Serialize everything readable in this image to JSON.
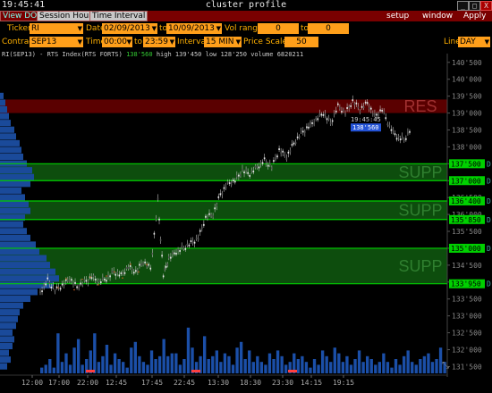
{
  "window": {
    "clock": "19:45:41",
    "title": "cluster profile",
    "minimize": "_",
    "maximize": "□",
    "close": "X"
  },
  "menu": {
    "left_tabs": [
      "View DOM",
      "Session Hours",
      "Time Interval"
    ],
    "right_items": [
      "setup",
      "window",
      "Apply"
    ]
  },
  "toolbar": {
    "ticker_label": "Ticker",
    "ticker": "RI",
    "date_label": "Date",
    "date_from": "02/09/2013",
    "date_to_label": "to",
    "date_to": "10/09/2013",
    "vol_label": "Vol range",
    "vol_from": "0",
    "vol_to_label": "to",
    "vol_to": "0",
    "contract_label": "Contract",
    "contract": "SEP13",
    "time_label": "Time",
    "time_from": "00:00",
    "time_to_label": "to",
    "time_to": "23:59",
    "interval_label": "Interval",
    "interval": "15 MIN",
    "price_scale_label": "Price Scale",
    "price_scale": "50",
    "line_label": "Line",
    "line": "DAY"
  },
  "info": {
    "symbol": "RI(SEP13) - RTS Index(RTS FORTS)",
    "last": "138'560",
    "high": "high 139'450",
    "low": "low 128'250",
    "volume": "volume 6820211"
  },
  "chart_data": {
    "type": "candlestick-with-volume-profile",
    "y_ticks": [
      "140'500",
      "140'000",
      "139'500",
      "139'000",
      "138'500",
      "138'000",
      "137'500",
      "137'000",
      "136'500",
      "136'000",
      "135'500",
      "135'000",
      "134'500",
      "134'000",
      "133'500",
      "133'000",
      "132'500",
      "132'000",
      "131'500"
    ],
    "ylim": [
      131300,
      140600
    ],
    "x_ticks": [
      "12:00",
      "17:00",
      "22:00",
      "12:45",
      "17:45",
      "22:45",
      "13:30",
      "18:30",
      "23:30",
      "14:15",
      "19:15"
    ],
    "current_price_time": "19:45:45",
    "current_price": "138'560",
    "zones": [
      {
        "name": "RES",
        "from": 139000,
        "to": 139400,
        "color": "#5a0000",
        "label_color": "#a03030"
      },
      {
        "name": "SUPP",
        "from": 137000,
        "to": 137500,
        "color": "#0d4d0d",
        "label_color": "#2f7f2f"
      },
      {
        "name": "SUPP",
        "from": 135850,
        "to": 136400,
        "color": "#0d4d0d",
        "label_color": "#2f7f2f"
      },
      {
        "name": "SUPP",
        "from": 133950,
        "to": 135000,
        "color": "#0d4d0d",
        "label_color": "#2f7f2f"
      }
    ],
    "levels": [
      {
        "price": 137500,
        "label": "137'500"
      },
      {
        "price": 137000,
        "label": "137'000"
      },
      {
        "price": 136400,
        "label": "136'400"
      },
      {
        "price": 135850,
        "label": "135'850"
      },
      {
        "price": 135000,
        "label": "135'000"
      },
      {
        "price": 133950,
        "label": "133'950"
      }
    ],
    "level_color": "#00d000",
    "level_suffix": "D",
    "price_path": [
      [
        0,
        133700
      ],
      [
        4,
        134050
      ],
      [
        8,
        133750
      ],
      [
        12,
        133900
      ],
      [
        16,
        134100
      ],
      [
        20,
        133850
      ],
      [
        24,
        134000
      ],
      [
        28,
        134150
      ],
      [
        32,
        134000
      ],
      [
        36,
        134100
      ],
      [
        40,
        134300
      ],
      [
        44,
        134200
      ],
      [
        48,
        134450
      ],
      [
        52,
        134300
      ],
      [
        56,
        134600
      ],
      [
        60,
        134400
      ],
      [
        64,
        136400
      ],
      [
        67,
        134200
      ],
      [
        70,
        134700
      ],
      [
        74,
        134900
      ],
      [
        78,
        135000
      ],
      [
        82,
        135150
      ],
      [
        86,
        135300
      ],
      [
        90,
        135900
      ],
      [
        94,
        136000
      ],
      [
        98,
        136600
      ],
      [
        102,
        136900
      ],
      [
        106,
        137000
      ],
      [
        110,
        137300
      ],
      [
        114,
        137200
      ],
      [
        118,
        137400
      ],
      [
        122,
        137600
      ],
      [
        126,
        137400
      ],
      [
        130,
        137900
      ],
      [
        134,
        137700
      ],
      [
        138,
        138100
      ],
      [
        142,
        138400
      ],
      [
        146,
        138600
      ],
      [
        150,
        138800
      ],
      [
        154,
        139000
      ],
      [
        158,
        138700
      ],
      [
        162,
        139200
      ],
      [
        166,
        139000
      ],
      [
        170,
        139350
      ],
      [
        174,
        139100
      ],
      [
        178,
        139300
      ],
      [
        182,
        138900
      ],
      [
        186,
        139100
      ],
      [
        190,
        138600
      ],
      [
        194,
        138300
      ],
      [
        198,
        138200
      ],
      [
        202,
        138560
      ]
    ],
    "volume_bars": [
      2,
      3,
      5,
      2,
      14,
      4,
      7,
      3,
      9,
      12,
      3,
      5,
      8,
      14,
      4,
      6,
      10,
      3,
      7,
      5,
      4,
      2,
      9,
      11,
      6,
      4,
      3,
      8,
      5,
      6,
      12,
      6,
      7,
      7,
      3,
      5,
      16,
      9,
      4,
      6,
      13,
      5,
      6,
      8,
      4,
      7,
      6,
      3,
      9,
      11,
      5,
      8,
      4,
      6,
      4,
      3,
      7,
      5,
      8,
      6,
      3,
      4,
      7,
      5,
      6,
      4,
      2,
      5,
      3,
      8,
      6,
      4,
      9,
      7,
      4,
      6,
      3,
      5,
      8,
      4,
      6,
      5,
      3,
      4,
      7,
      4,
      2,
      5,
      3,
      6,
      8,
      4,
      3,
      5,
      6,
      7,
      4,
      5,
      9,
      4
    ],
    "profile": [
      [
        131500,
        8
      ],
      [
        131700,
        12
      ],
      [
        131900,
        10
      ],
      [
        132100,
        14
      ],
      [
        132300,
        16
      ],
      [
        132500,
        14
      ],
      [
        132700,
        18
      ],
      [
        132900,
        20
      ],
      [
        133100,
        22
      ],
      [
        133300,
        26
      ],
      [
        133500,
        34
      ],
      [
        133700,
        42
      ],
      [
        133900,
        60
      ],
      [
        134100,
        66
      ],
      [
        134300,
        62
      ],
      [
        134500,
        56
      ],
      [
        134700,
        52
      ],
      [
        134900,
        44
      ],
      [
        135100,
        40
      ],
      [
        135300,
        34
      ],
      [
        135500,
        30
      ],
      [
        135700,
        26
      ],
      [
        135900,
        28
      ],
      [
        136100,
        34
      ],
      [
        136300,
        32
      ],
      [
        136500,
        28
      ],
      [
        136700,
        24
      ],
      [
        136900,
        34
      ],
      [
        137100,
        38
      ],
      [
        137300,
        36
      ],
      [
        137500,
        30
      ],
      [
        137700,
        26
      ],
      [
        137900,
        24
      ],
      [
        138100,
        22
      ],
      [
        138300,
        18
      ],
      [
        138500,
        16
      ],
      [
        138700,
        12
      ],
      [
        138900,
        10
      ],
      [
        139100,
        8
      ],
      [
        139300,
        6
      ],
      [
        139500,
        4
      ]
    ]
  }
}
